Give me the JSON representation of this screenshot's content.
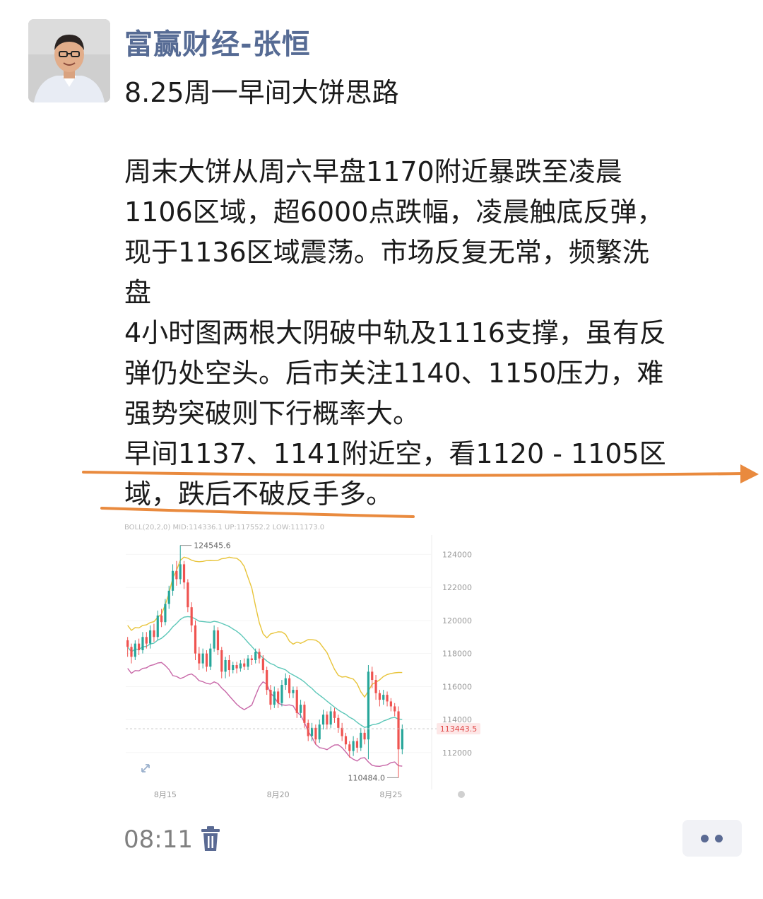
{
  "post": {
    "author": "富赢财经-张恒",
    "title": "8.25周一早间大饼思路",
    "body_lines": [
      "周末大饼从周六早盘1170附近暴跌至凌晨",
      "1106区域，超6000点跌幅，凌晨触底反弹，",
      "现于1136区域震荡。市场反复无常，频繁洗",
      "盘",
      "4小时图两根大阴破中轨及1116支撑，虽有反",
      "弹仍处空头。后市关注1140、1150压力，难",
      "强势突破则下行概率大。",
      "早间1137、1141附近空，看1120 - 1105区",
      "域，跌后不破反手多。"
    ],
    "time": "08:11",
    "icons": {
      "avatar": "author-avatar",
      "delete": "trash-icon",
      "more": "more-dots-icon",
      "expand": "expand-icon"
    },
    "colors": {
      "author": "#566b94",
      "annotation": "#e98a3e",
      "up": "#26a69a",
      "down": "#ef5350"
    }
  },
  "chart_data": {
    "type": "candlestick",
    "indicator_header": "BOLL(20,2,0) MID:114336.1 UP:117552.2 LOW:111173.0",
    "x_labels": [
      "8月15",
      "8月20",
      "8月25"
    ],
    "y_ticks": [
      124000,
      122000,
      120000,
      118000,
      116000,
      114000,
      112000
    ],
    "ylim": [
      110200,
      125000
    ],
    "high_label": "124545.6",
    "low_label": "110484.0",
    "last_price": "113443.5",
    "candles": [
      [
        118800,
        118400,
        119000,
        117800
      ],
      [
        118400,
        117800,
        118600,
        117400
      ],
      [
        117800,
        118600,
        118800,
        117600
      ],
      [
        118600,
        118200,
        118900,
        117900
      ],
      [
        118200,
        119000,
        119300,
        118000
      ],
      [
        119000,
        118600,
        119300,
        118300
      ],
      [
        118600,
        119400,
        119700,
        118300
      ],
      [
        119400,
        119000,
        119800,
        118700
      ],
      [
        119000,
        120300,
        120600,
        118800
      ],
      [
        120300,
        119900,
        120700,
        119600
      ],
      [
        119900,
        121000,
        121300,
        119700
      ],
      [
        121000,
        121800,
        122100,
        120700
      ],
      [
        121800,
        123000,
        123400,
        121500
      ],
      [
        123000,
        122500,
        123600,
        122100
      ],
      [
        122500,
        123400,
        124546,
        122200
      ],
      [
        123400,
        122300,
        123600,
        121900
      ],
      [
        122300,
        120800,
        122500,
        120500
      ],
      [
        120800,
        119700,
        121100,
        119300
      ],
      [
        119700,
        118000,
        120000,
        117600
      ],
      [
        118000,
        117400,
        118400,
        117000
      ],
      [
        117400,
        118000,
        118300,
        117100
      ],
      [
        118000,
        117200,
        118200,
        116900
      ],
      [
        117200,
        118300,
        118600,
        117000
      ],
      [
        118300,
        119400,
        119700,
        118100
      ],
      [
        119400,
        118200,
        119600,
        117900
      ],
      [
        118200,
        116900,
        118400,
        116500
      ],
      [
        116900,
        117600,
        117800,
        116500
      ],
      [
        117600,
        117000,
        117900,
        116600
      ],
      [
        117000,
        117300,
        117500,
        116800
      ],
      [
        117300,
        117100,
        117500,
        116800
      ],
      [
        117100,
        117400,
        117600,
        116900
      ],
      [
        117400,
        117200,
        117700,
        117000
      ],
      [
        117200,
        117700,
        117900,
        117000
      ],
      [
        117700,
        117600,
        117900,
        117300
      ],
      [
        117600,
        118100,
        118300,
        117400
      ],
      [
        118100,
        117700,
        118300,
        117400
      ],
      [
        117700,
        117000,
        117900,
        116800
      ],
      [
        117000,
        115800,
        117200,
        115500
      ],
      [
        115800,
        114900,
        116100,
        114600
      ],
      [
        114900,
        115700,
        116000,
        114700
      ],
      [
        115700,
        115000,
        115900,
        114700
      ],
      [
        115000,
        116100,
        116400,
        114800
      ],
      [
        116100,
        116500,
        116800,
        115800
      ],
      [
        116500,
        115600,
        116700,
        115300
      ],
      [
        115600,
        115800,
        116000,
        115300
      ],
      [
        115800,
        114400,
        116000,
        114100
      ],
      [
        114400,
        114900,
        115200,
        114100
      ],
      [
        114900,
        113800,
        115100,
        113500
      ],
      [
        113800,
        113000,
        114000,
        112700
      ],
      [
        113000,
        113500,
        113800,
        112700
      ],
      [
        113500,
        112800,
        113700,
        112500
      ],
      [
        112800,
        113700,
        114000,
        112600
      ],
      [
        113700,
        114300,
        114600,
        113400
      ],
      [
        114300,
        113700,
        114500,
        113400
      ],
      [
        113700,
        114500,
        114800,
        113500
      ],
      [
        114500,
        114100,
        114700,
        113800
      ],
      [
        114100,
        113500,
        114300,
        113200
      ],
      [
        113500,
        113000,
        113800,
        112700
      ],
      [
        113000,
        112500,
        113200,
        112200
      ],
      [
        112500,
        112100,
        112700,
        111700
      ],
      [
        112100,
        112700,
        113000,
        111800
      ],
      [
        112700,
        112300,
        112900,
        112000
      ],
      [
        112300,
        113200,
        113500,
        112100
      ],
      [
        113200,
        112800,
        113400,
        112500
      ],
      [
        112800,
        116900,
        117300,
        111600
      ],
      [
        116900,
        116400,
        117200,
        115900
      ],
      [
        116400,
        115600,
        116700,
        115200
      ],
      [
        115600,
        115200,
        115800,
        114800
      ],
      [
        115200,
        115500,
        115800,
        114900
      ],
      [
        115500,
        115100,
        115700,
        114800
      ],
      [
        115100,
        114800,
        115300,
        114500
      ],
      [
        114800,
        114500,
        115000,
        114200
      ],
      [
        114500,
        112200,
        114800,
        110484
      ],
      [
        112200,
        113443,
        113700,
        111900
      ]
    ]
  }
}
